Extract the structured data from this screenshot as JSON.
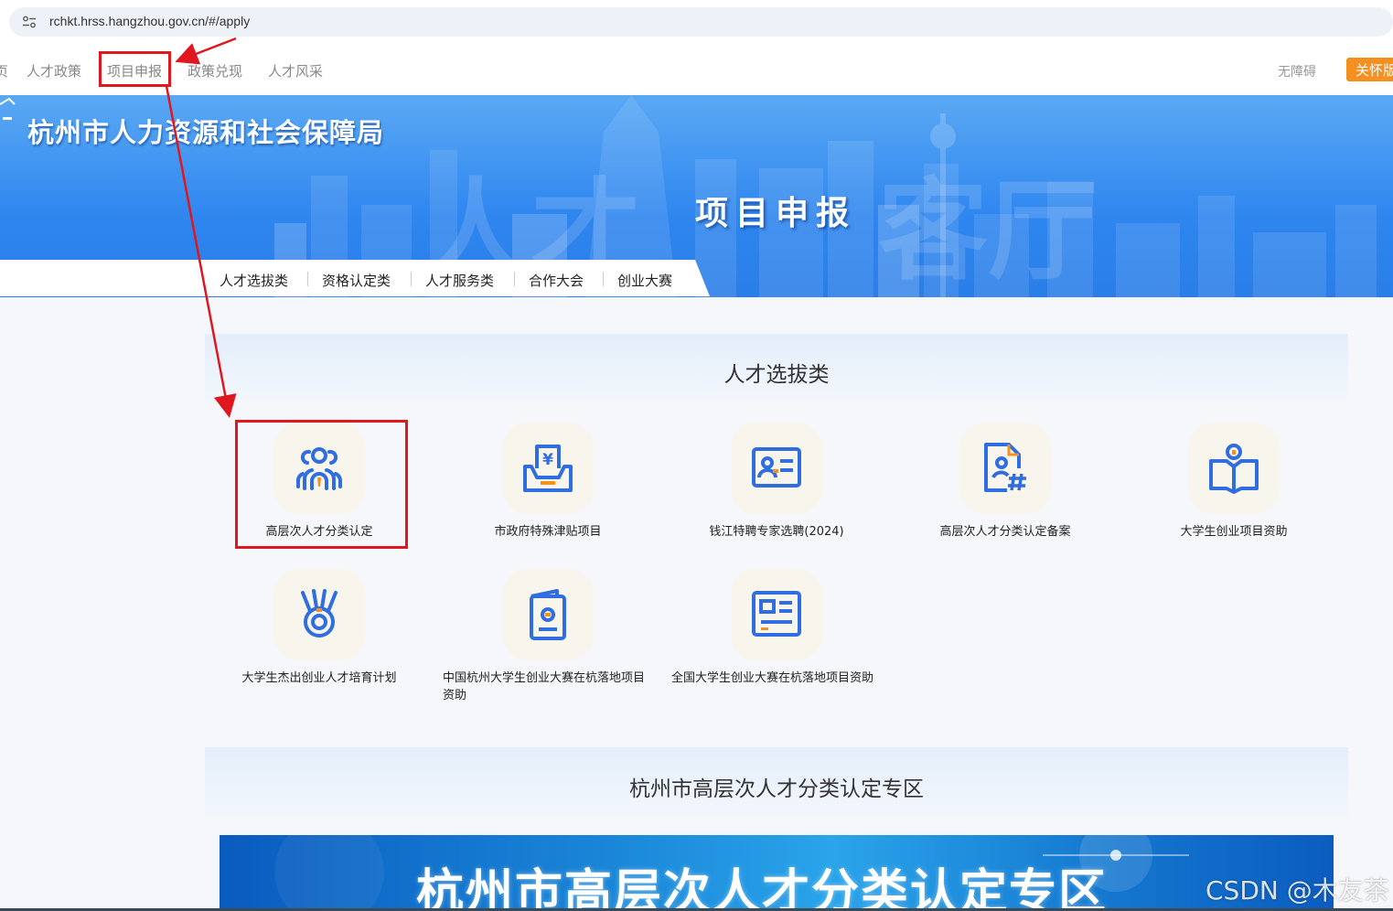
{
  "browser": {
    "url": "rchkt.hrss.hangzhou.gov.cn/#/apply"
  },
  "topnav": {
    "items": [
      "页",
      "人才政策",
      "项目申报",
      "政策兑现",
      "人才风采"
    ],
    "accessibility": "无障碍",
    "care_mode": "关怀版"
  },
  "banner": {
    "org_name": "杭州市人力资源和社会保障局",
    "title": "项目申报"
  },
  "tabs": [
    "人才选拔类",
    "资格认定类",
    "人才服务类",
    "合作大会",
    "创业大赛"
  ],
  "section": {
    "title": "人才选拔类",
    "items": [
      {
        "label": "高层次人才分类认定",
        "icon": "people-group-icon"
      },
      {
        "label": "市政府特殊津贴项目",
        "icon": "yen-document-icon"
      },
      {
        "label": "钱江特聘专家选聘(2024)",
        "icon": "id-card-icon"
      },
      {
        "label": "高层次人才分类认定备案",
        "icon": "file-user-hash-icon"
      },
      {
        "label": "大学生创业项目资助",
        "icon": "open-book-icon"
      },
      {
        "label": "大学生杰出创业人才培育计划",
        "icon": "medal-icon"
      },
      {
        "label": "中国杭州大学生创业大赛在杭落地项目资助",
        "icon": "passport-icon"
      },
      {
        "label": "全国大学生创业大赛在杭落地项目资助",
        "icon": "news-card-icon"
      }
    ]
  },
  "zone": {
    "title": "杭州市高层次人才分类认定专区",
    "banner_text": "杭州市高层次人才分类认定专区"
  },
  "watermark": "CSDN @木友茶",
  "colors": {
    "accent": "#2f86ef",
    "icon_blue": "#2f6de0",
    "highlight": "#e0171f",
    "care_orange": "#f39020"
  }
}
